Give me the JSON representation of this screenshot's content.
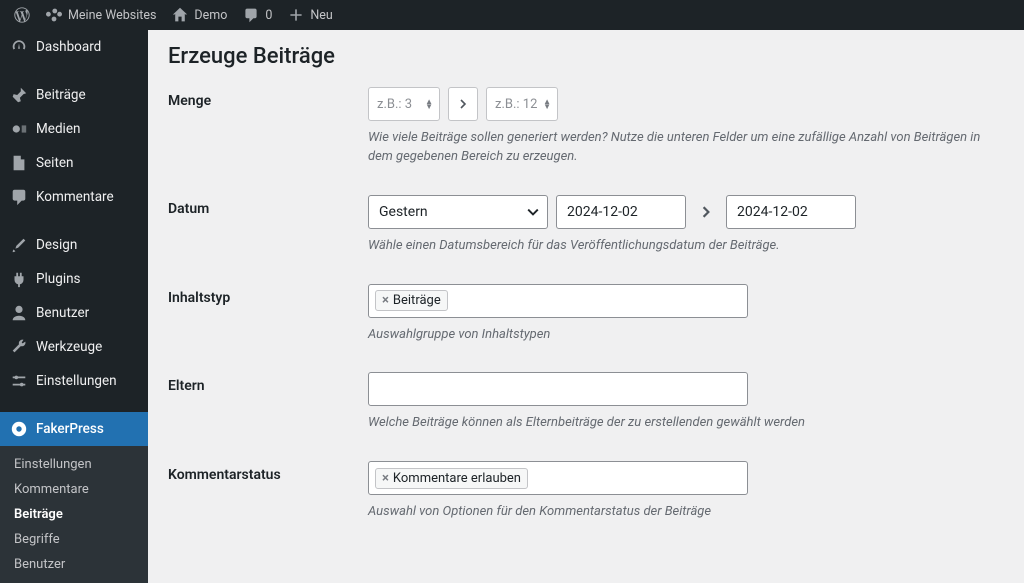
{
  "adminbar": {
    "my_sites": "Meine Websites",
    "site_name": "Demo",
    "comments_count": "0",
    "new_label": "Neu"
  },
  "sidebar": {
    "items": [
      {
        "label": "Dashboard"
      },
      {
        "label": "Beiträge"
      },
      {
        "label": "Medien"
      },
      {
        "label": "Seiten"
      },
      {
        "label": "Kommentare"
      },
      {
        "label": "Design"
      },
      {
        "label": "Plugins"
      },
      {
        "label": "Benutzer"
      },
      {
        "label": "Werkzeuge"
      },
      {
        "label": "Einstellungen"
      },
      {
        "label": "FakerPress"
      }
    ],
    "submenu": [
      {
        "label": "Einstellungen"
      },
      {
        "label": "Kommentare"
      },
      {
        "label": "Beiträge"
      },
      {
        "label": "Begriffe"
      },
      {
        "label": "Benutzer"
      }
    ]
  },
  "page": {
    "title": "Erzeuge Beiträge",
    "fields": {
      "qty": {
        "label": "Menge",
        "min_placeholder": "z.B.: 3",
        "max_placeholder": "z.B.: 12",
        "desc": "Wie viele Beiträge sollen generiert werden? Nutze die unteren Felder um eine zufällige Anzahl von Beiträgen in dem gegebenen Bereich zu erzeugen."
      },
      "date": {
        "label": "Datum",
        "preset": "Gestern",
        "from": "2024-12-02",
        "to": "2024-12-02",
        "desc": "Wähle einen Datumsbereich für das Veröffentlichungsdatum der Beiträge."
      },
      "content_type": {
        "label": "Inhaltstyp",
        "tag": "Beiträge",
        "desc": "Auswahlgruppe von Inhaltstypen"
      },
      "parent": {
        "label": "Eltern",
        "desc": "Welche Beiträge können als Elternbeiträge der zu erstellenden gewählt werden"
      },
      "comment_status": {
        "label": "Kommentarstatus",
        "tag": "Kommentare erlauben",
        "desc": "Auswahl von Optionen für den Kommentarstatus der Beiträge"
      }
    }
  }
}
